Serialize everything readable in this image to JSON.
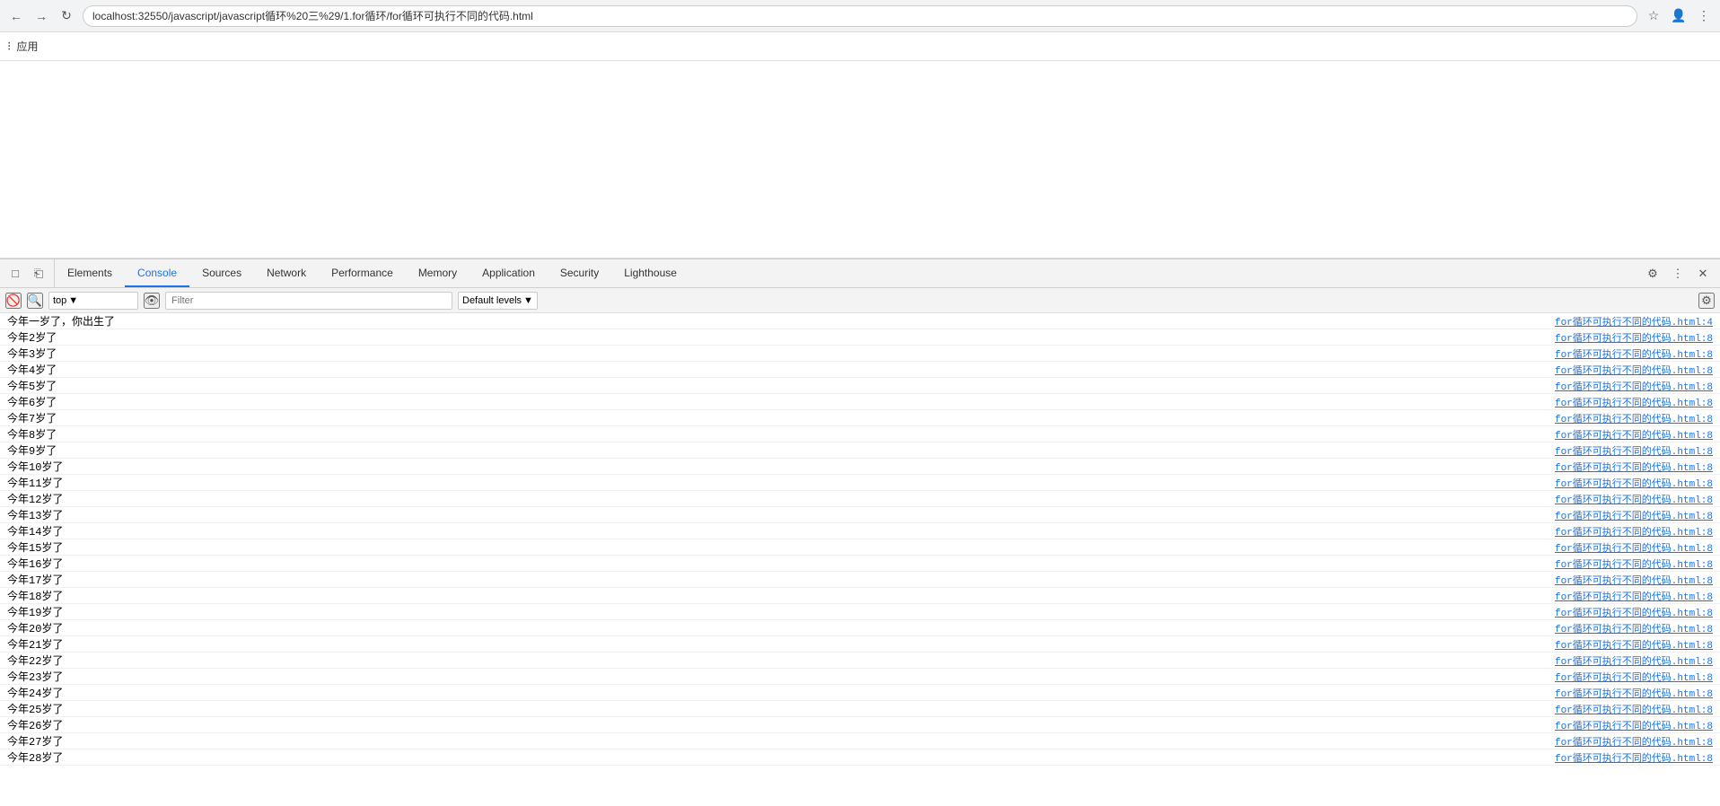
{
  "browser": {
    "address": "localhost:32550/javascript/javascript循环%20三%29/1.for循环/for循环可执行不同的代码.html",
    "apps_label": "应用"
  },
  "devtools": {
    "tabs": [
      {
        "id": "elements",
        "label": "Elements",
        "active": false
      },
      {
        "id": "console",
        "label": "Console",
        "active": true
      },
      {
        "id": "sources",
        "label": "Sources",
        "active": false
      },
      {
        "id": "network",
        "label": "Network",
        "active": false
      },
      {
        "id": "performance",
        "label": "Performance",
        "active": false
      },
      {
        "id": "memory",
        "label": "Memory",
        "active": false
      },
      {
        "id": "application",
        "label": "Application",
        "active": false
      },
      {
        "id": "security",
        "label": "Security",
        "active": false
      },
      {
        "id": "lighthouse",
        "label": "Lighthouse",
        "active": false
      }
    ]
  },
  "console_toolbar": {
    "top_value": "top",
    "filter_placeholder": "Filter",
    "default_levels": "Default levels"
  },
  "console_rows": [
    {
      "text": "今年一岁了，你出生了",
      "link": "for循环可执行不同的代码.html:4"
    },
    {
      "text": "今年2岁了",
      "link": "for循环可执行不同的代码.html:8"
    },
    {
      "text": "今年3岁了",
      "link": "for循环可执行不同的代码.html:8"
    },
    {
      "text": "今年4岁了",
      "link": "for循环可执行不同的代码.html:8"
    },
    {
      "text": "今年5岁了",
      "link": "for循环可执行不同的代码.html:8"
    },
    {
      "text": "今年6岁了",
      "link": "for循环可执行不同的代码.html:8"
    },
    {
      "text": "今年7岁了",
      "link": "for循环可执行不同的代码.html:8"
    },
    {
      "text": "今年8岁了",
      "link": "for循环可执行不同的代码.html:8"
    },
    {
      "text": "今年9岁了",
      "link": "for循环可执行不同的代码.html:8"
    },
    {
      "text": "今年10岁了",
      "link": "for循环可执行不同的代码.html:8"
    },
    {
      "text": "今年11岁了",
      "link": "for循环可执行不同的代码.html:8"
    },
    {
      "text": "今年12岁了",
      "link": "for循环可执行不同的代码.html:8"
    },
    {
      "text": "今年13岁了",
      "link": "for循环可执行不同的代码.html:8"
    },
    {
      "text": "今年14岁了",
      "link": "for循环可执行不同的代码.html:8"
    },
    {
      "text": "今年15岁了",
      "link": "for循环可执行不同的代码.html:8"
    },
    {
      "text": "今年16岁了",
      "link": "for循环可执行不同的代码.html:8"
    },
    {
      "text": "今年17岁了",
      "link": "for循环可执行不同的代码.html:8"
    },
    {
      "text": "今年18岁了",
      "link": "for循环可执行不同的代码.html:8"
    },
    {
      "text": "今年19岁了",
      "link": "for循环可执行不同的代码.html:8"
    },
    {
      "text": "今年20岁了",
      "link": "for循环可执行不同的代码.html:8"
    },
    {
      "text": "今年21岁了",
      "link": "for循环可执行不同的代码.html:8"
    },
    {
      "text": "今年22岁了",
      "link": "for循环可执行不同的代码.html:8"
    },
    {
      "text": "今年23岁了",
      "link": "for循环可执行不同的代码.html:8"
    },
    {
      "text": "今年24岁了",
      "link": "for循环可执行不同的代码.html:8"
    },
    {
      "text": "今年25岁了",
      "link": "for循环可执行不同的代码.html:8"
    },
    {
      "text": "今年26岁了",
      "link": "for循环可执行不同的代码.html:8"
    },
    {
      "text": "今年27岁了",
      "link": "for循环可执行不同的代码.html:8"
    },
    {
      "text": "今年28岁了",
      "link": "for循环可执行不同的代码.html:8"
    }
  ]
}
